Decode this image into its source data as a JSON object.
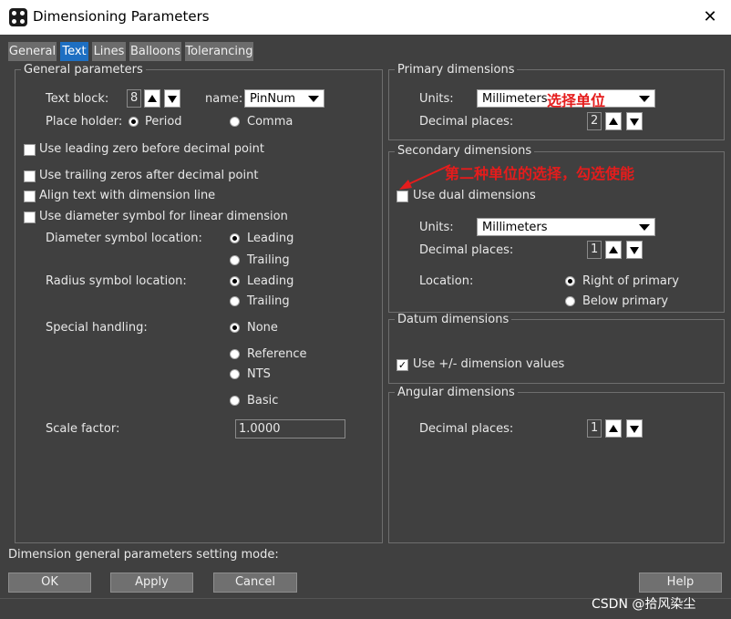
{
  "window": {
    "title": "Dimensioning Parameters",
    "close_glyph": "✕",
    "app_icon": "app-logo-icon"
  },
  "tabs": [
    {
      "label": "General",
      "active": false
    },
    {
      "label": "Text",
      "active": true
    },
    {
      "label": "Lines",
      "active": false
    },
    {
      "label": "Balloons",
      "active": false
    },
    {
      "label": "Tolerancing",
      "active": false
    }
  ],
  "general": {
    "title": "General parameters",
    "text_block_label": "Text block:",
    "text_block_value": "8",
    "name_label": "name:",
    "name_value": "PinNum",
    "place_holder_label": "Place holder:",
    "place_holder_options": [
      "Period",
      "Comma"
    ],
    "place_holder_selected": "Period",
    "checkboxes": [
      {
        "label": "Use leading zero before decimal point",
        "checked": false
      },
      {
        "label": "Use trailing zeros after decimal point",
        "checked": false
      },
      {
        "label": "Align text with dimension line",
        "checked": false
      },
      {
        "label": "Use diameter symbol for linear dimension",
        "checked": false
      }
    ],
    "diameter_location_label": "Diameter symbol location:",
    "diameter_options": [
      "Leading",
      "Trailing"
    ],
    "diameter_selected": "Leading",
    "radius_location_label": "Radius symbol location:",
    "radius_options": [
      "Leading",
      "Trailing"
    ],
    "radius_selected": "Leading",
    "special_handling_label": "Special handling:",
    "special_options": [
      "None",
      "Reference",
      "NTS",
      "Basic"
    ],
    "special_selected": "None",
    "scale_factor_label": "Scale factor:",
    "scale_factor_value": "1.0000"
  },
  "primary": {
    "title": "Primary dimensions",
    "units_label": "Units:",
    "units_value": "Millimeters",
    "decimal_label": "Decimal places:",
    "decimal_value": "2"
  },
  "secondary": {
    "title": "Secondary dimensions",
    "dual_label": "Use dual dimensions",
    "dual_checked": false,
    "units_label": "Units:",
    "units_value": "Millimeters",
    "decimal_label": "Decimal places:",
    "decimal_value": "1",
    "location_label": "Location:",
    "location_options": [
      "Right of primary",
      "Below primary"
    ],
    "location_selected": "Right of primary"
  },
  "datum": {
    "title": "Datum dimensions",
    "pm_label": "Use +/- dimension values",
    "pm_checked": true
  },
  "angular": {
    "title": "Angular dimensions",
    "decimal_label": "Decimal places:",
    "decimal_value": "1"
  },
  "status_text": "Dimension general parameters setting mode:",
  "buttons": {
    "ok": "OK",
    "apply": "Apply",
    "cancel": "Cancel",
    "help": "Help"
  },
  "annotations": {
    "units_note": "选择单位",
    "dual_note": "第二种单位的选择，勾选使能",
    "color": "#e51c1c"
  },
  "watermark": "CSDN @拾风染尘"
}
